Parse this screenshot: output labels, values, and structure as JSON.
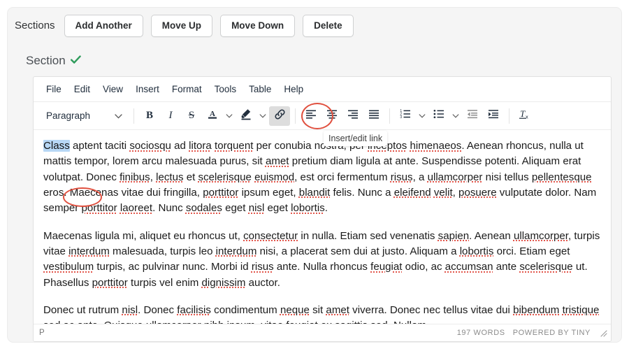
{
  "sections": {
    "label": "Sections",
    "buttons": [
      {
        "name": "add-another-button",
        "label": "Add Another"
      },
      {
        "name": "move-up-button",
        "label": "Move Up"
      },
      {
        "name": "move-down-button",
        "label": "Move Down"
      },
      {
        "name": "delete-button",
        "label": "Delete"
      }
    ],
    "section_title": "Section",
    "section_status_icon": "check-icon",
    "check_color": "#2e9b5b"
  },
  "editor": {
    "menubar": [
      "File",
      "Edit",
      "View",
      "Insert",
      "Format",
      "Tools",
      "Table",
      "Help"
    ],
    "toolbar": {
      "style_select_value": "Paragraph",
      "bold_label": "B",
      "italic_label": "I",
      "strikethrough_label": "S",
      "text_color_label": "A",
      "clear_format_label": "Tx",
      "active_button": "insert-edit-link-button"
    },
    "tooltip": "Insert/edit link",
    "selection": "Class",
    "paragraphs": [
      "Class aptent taciti sociosqu ad litora torquent per conubia nostra, per inceptos himenaeos. Aenean rhoncus, nulla ut mattis tempor, lorem arcu malesuada purus, sit amet pretium diam ligula at ante. Suspendisse potenti. Aliquam erat volutpat. Donec finibus, lectus et scelerisque euismod, est orci fermentum risus, a ullamcorper nisi tellus pellentesque eros. Maecenas vitae dui fringilla, porttitor ipsum eget, blandit felis. Nunc a eleifend velit, posuere vulputate dolor. Nam semper porttitor laoreet. Nunc sodales eget nisl eget lobortis.",
      "Maecenas ligula mi, aliquet eu rhoncus ut, consectetur in nulla. Etiam sed venenatis sapien. Aenean ullamcorper, turpis vitae interdum malesuada, turpis leo interdum nisi, a placerat sem dui at justo. Aliquam a lobortis orci. Etiam eget vestibulum turpis, ac pulvinar nunc. Morbi id risus ante. Nulla rhoncus feugiat odio, ac accumsan ante scelerisque ut. Phasellus porttitor turpis vel enim dignissim auctor.",
      "Donec ut rutrum nisl. Donec facilisis condimentum neque sit amet viverra. Donec nec tellus vitae dui bibendum tristique sed ac ante. Quisque ullamcorper nibh ipsum, vitae feugiat ex sagittis sed. Nullam"
    ],
    "statusbar": {
      "path": "P",
      "word_count": "197 WORDS",
      "branding": "POWERED BY TINY",
      "resize_icon": "resize-grip-icon"
    }
  },
  "annotations": {
    "link_circle_color": "#e0503f",
    "class_circle_color": "#e0503f",
    "selection_highlight_color": "#b7d7f5"
  }
}
